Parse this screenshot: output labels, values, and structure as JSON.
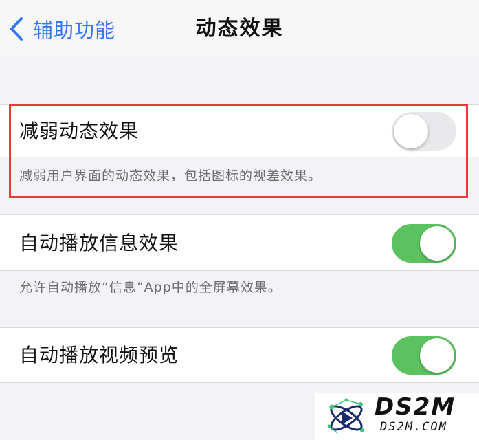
{
  "nav": {
    "back_label": "辅助功能",
    "title": "动态效果"
  },
  "settings": [
    {
      "label": "减弱动态效果",
      "state": "off",
      "footer": "减弱用户界面的动态效果，包括图标的视差效果。"
    },
    {
      "label": "自动播放信息效果",
      "state": "on",
      "footer": "允许自动播放“信息”App中的全屏幕效果。"
    },
    {
      "label": "自动播放视频预览",
      "state": "on"
    }
  ],
  "watermark": {
    "main": "DS2M",
    "sub": "DS2M.COM"
  },
  "colors": {
    "accent": "#3478f6",
    "switch_on": "#5ac35f",
    "switch_off": "#e9e9eb",
    "highlight": "#e8393b",
    "background": "#f2f2f7"
  },
  "icons": {
    "back": "chevron-left-icon",
    "watermark_logo": "atom-logo-icon"
  }
}
